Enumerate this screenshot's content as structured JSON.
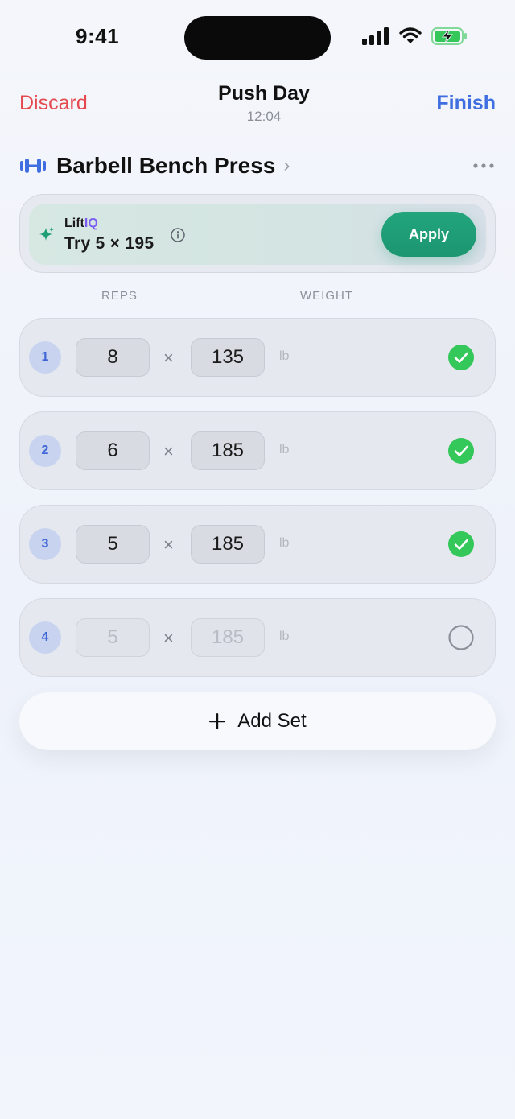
{
  "status_bar": {
    "time": "9:41"
  },
  "nav": {
    "discard_label": "Discard",
    "title": "Push Day",
    "elapsed": "12:04",
    "finish_label": "Finish"
  },
  "exercise": {
    "name": "Barbell Bench Press",
    "chevron": "›"
  },
  "liftiq": {
    "brand_prefix": "Lift",
    "brand_suffix": "IQ",
    "suggestion": "Try 5 × 195",
    "apply_label": "Apply"
  },
  "columns": {
    "reps": "REPS",
    "weight": "WEIGHT"
  },
  "sets": [
    {
      "number": "1",
      "reps": "8",
      "weight": "135",
      "unit": "lb",
      "completed": true
    },
    {
      "number": "2",
      "reps": "6",
      "weight": "185",
      "unit": "lb",
      "completed": true
    },
    {
      "number": "3",
      "reps": "5",
      "weight": "185",
      "unit": "lb",
      "completed": true
    },
    {
      "number": "4",
      "reps": "5",
      "weight": "185",
      "unit": "lb",
      "completed": false
    }
  ],
  "times_symbol": "×",
  "add_set_label": "Add Set",
  "colors": {
    "discard": "#e5484d",
    "finish": "#3f6ee0",
    "apply": "#1f9e76",
    "check": "#34c759",
    "iq": "#7b5cf0"
  },
  "icons": {
    "barbell": "barbell-icon",
    "more": "more-horizontal-icon",
    "sparkle": "sparkle-icon",
    "info": "info-circle-icon",
    "check": "checkmark-circle-icon",
    "empty": "empty-circle-icon",
    "plus": "plus-icon"
  }
}
